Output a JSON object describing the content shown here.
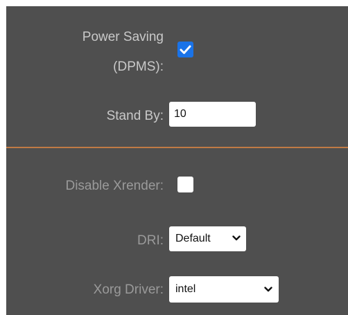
{
  "power_saving": {
    "label_line1": "Power Saving",
    "label_line2": "(DPMS):",
    "checked": true
  },
  "stand_by": {
    "label": "Stand By:",
    "value": "10"
  },
  "disable_xrender": {
    "label": "Disable Xrender:",
    "checked": false
  },
  "dri": {
    "label": "DRI:",
    "selected": "Default"
  },
  "xorg_driver": {
    "label": "Xorg Driver:",
    "selected": "intel"
  },
  "colors": {
    "panel_bg": "#4f4f4f",
    "divider": "#c07a45",
    "checkbox_accent": "#1a73e8"
  },
  "icons": {
    "checkmark": "check-icon",
    "dropdown": "chevron-down-icon"
  }
}
